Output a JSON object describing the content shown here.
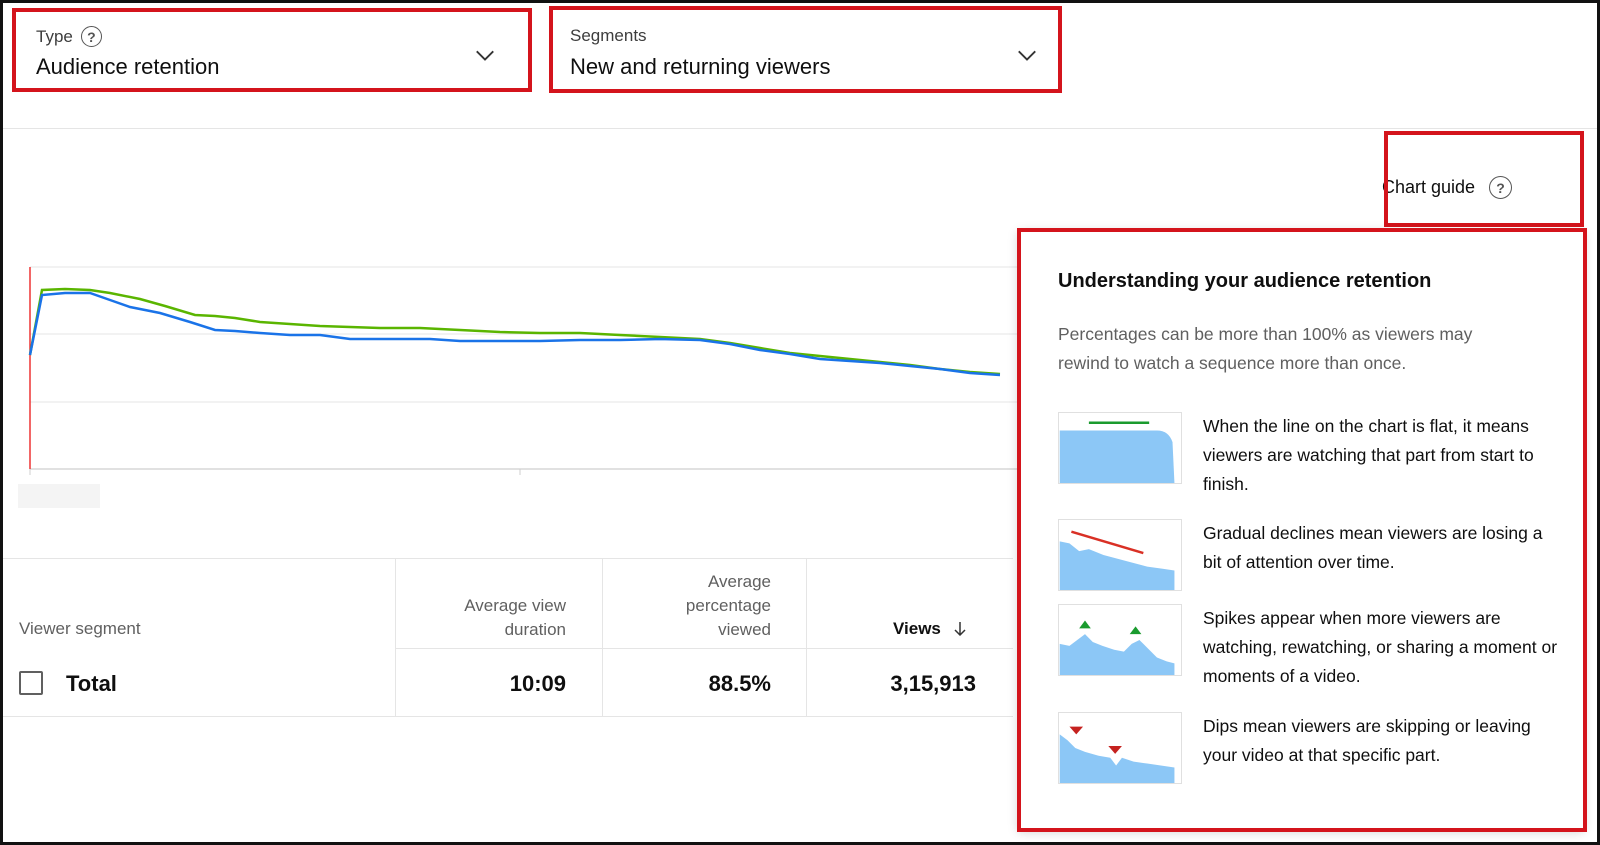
{
  "type_dropdown": {
    "label": "Type",
    "value": "Audience retention"
  },
  "segments_dropdown": {
    "label": "Segments",
    "value": "New and returning viewers"
  },
  "chart_guide": {
    "label": "Chart guide"
  },
  "chart": {
    "series": [
      {
        "name": "",
        "color": "#1a73e8"
      },
      {
        "name": "",
        "color": "#5ab500"
      }
    ]
  },
  "table": {
    "headers": {
      "segment": "Viewer segment",
      "avg_view_duration": [
        "Average view",
        "duration"
      ],
      "avg_pct_viewed": [
        "Average",
        "percentage",
        "viewed"
      ],
      "views": "Views"
    },
    "rows": [
      {
        "label": "Total",
        "avg_view_duration": "10:09",
        "avg_pct_viewed": "88.5%",
        "views": "3,15,913"
      }
    ]
  },
  "guide": {
    "title": "Understanding your audience retention",
    "subtitle": "Percentages can be more than 100% as viewers may rewind to watch a sequence more than once.",
    "items": [
      {
        "icon": "flat-line-chart-icon",
        "text": "When the line on the chart is flat, it means viewers are watching that part from start to finish."
      },
      {
        "icon": "gradual-decline-chart-icon",
        "text": "Gradual declines mean viewers are losing a bit of attention over time."
      },
      {
        "icon": "spikes-chart-icon",
        "text": "Spikes appear when more viewers are watching, rewatching, or sharing a moment or moments of a video."
      },
      {
        "icon": "dips-chart-icon",
        "text": "Dips mean viewers are skipping or leaving your video at that specific part."
      }
    ]
  },
  "colors": {
    "highlight": "#d4141c",
    "accent_green": "#5ab500",
    "accent_blue": "#1a73e8"
  }
}
